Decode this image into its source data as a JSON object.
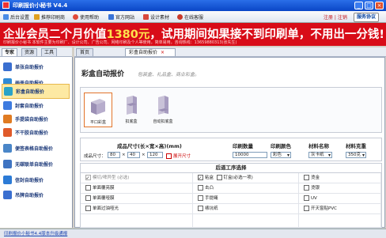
{
  "window": {
    "title": "印刷报价小秘书 V4.4",
    "controls": [
      "_",
      "□",
      "×"
    ]
  },
  "toolbar": {
    "items": [
      {
        "label": "后台设置",
        "icon": "settings-icon",
        "color": "#4a8be6"
      },
      {
        "label": "推荐印刷商",
        "icon": "printer-icon",
        "color": "#e0a020"
      },
      {
        "label": "使用帮助",
        "icon": "help-icon",
        "color": "#e14b3a"
      },
      {
        "label": "官方网站",
        "icon": "globe-icon",
        "color": "#3a74d8"
      },
      {
        "label": "设计素材",
        "icon": "design-icon",
        "color": "#d9483b"
      },
      {
        "label": "在线客服",
        "icon": "support-icon",
        "color": "#c93a2a"
      }
    ],
    "register": "注册 | 注销",
    "service": "服务协议"
  },
  "banner": {
    "text_before": "企业会员",
    "text_mid": "二个月价值",
    "highlight": "1380元",
    "text_after": "，试用期间如果接不到印刷单，不用出一分钱!",
    "small": "印刷报价小秘书 本软件主要为印刷厂、设计公司、广告公司、网络印刷及个人等使用，简单易用，咨询热线：13659880313(张先生)"
  },
  "sidebar": {
    "tabs": [
      "专家",
      "资源",
      "工具"
    ],
    "active_tab": 0,
    "items": [
      {
        "label": "单张自助报价",
        "icon": "single-sheet-icon",
        "color": "#3a6fd0"
      },
      {
        "label": "画册自助报价",
        "icon": "album-icon",
        "color": "#2f8ad6"
      },
      {
        "label": "彩盒自助报价",
        "icon": "color-box-icon",
        "color": "#2aa3c8",
        "active": true
      },
      {
        "label": "封套自助报价",
        "icon": "envelope-icon",
        "color": "#3d7be0"
      },
      {
        "label": "手提袋自助报价",
        "icon": "handbag-icon",
        "color": "#e07b22"
      },
      {
        "label": "不干胶自助报价",
        "icon": "sticker-icon",
        "color": "#e05a2a"
      },
      {
        "label": "便签表格自助报价",
        "icon": "memo-form-icon",
        "color": "#4a86c8"
      },
      {
        "label": "无碳联单自助报价",
        "icon": "carbonless-form-icon",
        "color": "#3f74c2"
      },
      {
        "label": "信封自助报价",
        "icon": "letter-envelope-icon",
        "color": "#2c7bd6"
      },
      {
        "label": "吊牌自助报价",
        "icon": "tag-icon",
        "color": "#3a6fd0"
      }
    ]
  },
  "main_tabs": [
    {
      "label": "首页",
      "active": false
    },
    {
      "label": "彩盒自助报价",
      "active": true,
      "close": "×"
    }
  ],
  "main": {
    "heading": "彩盒自动报价",
    "subheading": "包装盒、礼品盒、商业彩盒。",
    "products": [
      {
        "label": "平口彩盒",
        "active": true
      },
      {
        "label": "扣底盒",
        "active": false
      },
      {
        "label": "自动扣底盒",
        "active": false
      }
    ],
    "spec": {
      "size_header": "成品尺寸(长×宽×高)(mm)",
      "qty_header": "印刷数量",
      "color_header": "印刷颜色",
      "material_header": "材料名称",
      "weight_header": "材料克重",
      "size_label": "成品尺寸：",
      "length": "80",
      "width": "40",
      "height": "120",
      "expand_label": "展开尺寸",
      "quantity": "10000",
      "color": "彩色",
      "material": "灰卡纸",
      "weight": "350克",
      "sep": "×"
    },
    "post": {
      "header": "后道工序选择",
      "options": [
        {
          "label": "模切/啤异型 (必选)",
          "checked": true,
          "disabled": true
        },
        {
          "label": "粘盒",
          "checked": true
        },
        {
          "label": "钉盒(必选一项)",
          "checked": false
        },
        {
          "label": "烫金",
          "checked": false
        },
        {
          "label": "单面覆亮膜",
          "checked": false
        },
        {
          "label": "击凸",
          "checked": false
        },
        {
          "label": "",
          "checked": false
        },
        {
          "label": "烫银",
          "checked": false
        },
        {
          "label": "单面覆哑膜",
          "checked": false
        },
        {
          "label": "手提绳",
          "checked": false
        },
        {
          "label": "",
          "checked": false
        },
        {
          "label": "UV",
          "checked": false
        },
        {
          "label": "单面过油哑光",
          "checked": false
        },
        {
          "label": "裱坑纸",
          "checked": false
        },
        {
          "label": "",
          "checked": false
        },
        {
          "label": "开天窗贴PVC",
          "checked": false
        }
      ]
    }
  },
  "status": {
    "text": "印刷报价小秘书4.4版本升级通报"
  }
}
